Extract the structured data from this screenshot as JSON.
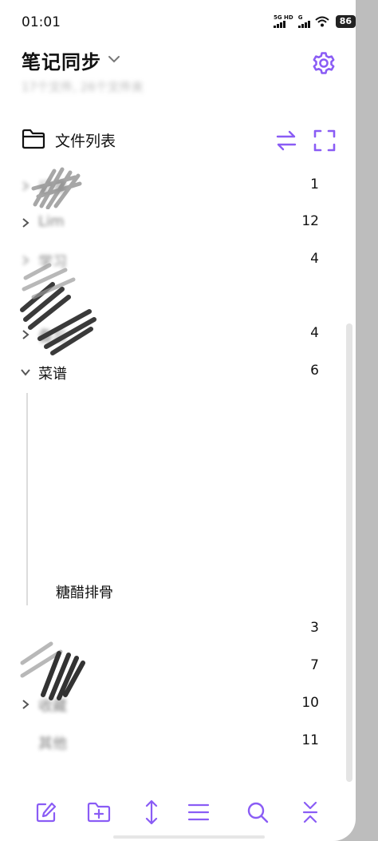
{
  "status_bar": {
    "time": "01:01",
    "signal1_label": "5G HD",
    "signal2_label": "G",
    "battery": "86"
  },
  "header": {
    "title": "笔记同步",
    "subtitle": "17个文件, 26个文件夹"
  },
  "file_list": {
    "title": "文件列表",
    "folders": [
      {
        "name": "记录",
        "count": "1",
        "blurred": true
      },
      {
        "name": "Lim",
        "count": "12",
        "blurred": true
      },
      {
        "name": "学习",
        "count": "4",
        "blurred": true
      },
      {
        "name": "",
        "count": "",
        "blurred": true
      },
      {
        "name": "备忘",
        "count": "4",
        "blurred": true
      },
      {
        "name": "菜谱",
        "count": "6",
        "blurred": false,
        "expanded": true
      },
      {
        "name": "",
        "count": "3",
        "blurred": true
      },
      {
        "name": "",
        "count": "7",
        "blurred": true
      },
      {
        "name": "收藏",
        "count": "10",
        "blurred": true
      },
      {
        "name": "其他",
        "count": "11",
        "blurred": true
      }
    ],
    "child_note": "糖醋排骨"
  },
  "accent_color": "#8a5cf5",
  "icons": [
    "settings-icon",
    "folder-icon",
    "swap-icon",
    "expand-icon",
    "new-note-icon",
    "new-folder-icon",
    "sort-icon",
    "menu-icon",
    "search-icon",
    "collapse-icon"
  ]
}
